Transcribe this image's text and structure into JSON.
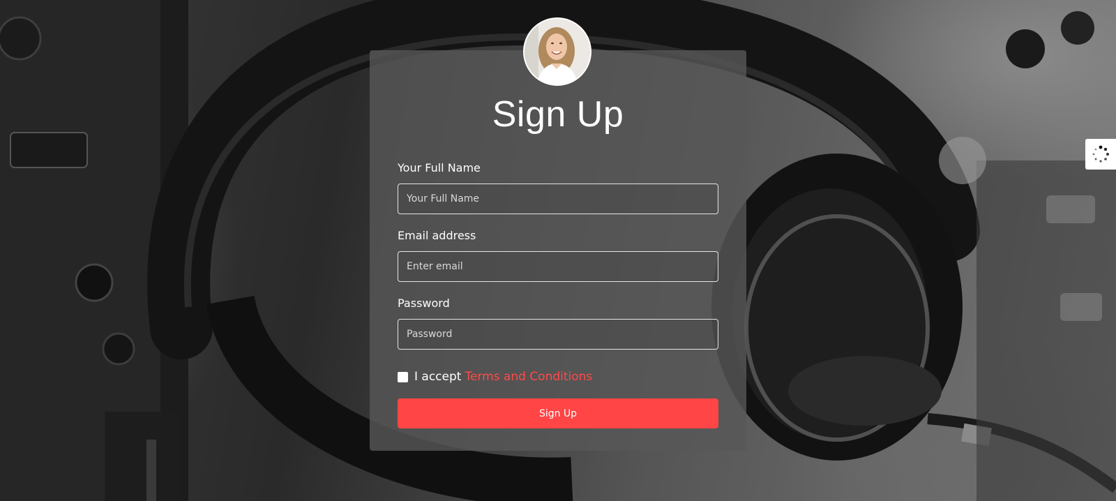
{
  "form": {
    "title": "Sign Up",
    "fields": [
      {
        "label": "Your Full Name",
        "placeholder": "Your Full Name",
        "value": ""
      },
      {
        "label": "Email address",
        "placeholder": "Enter email",
        "value": ""
      },
      {
        "label": "Password",
        "placeholder": "Password",
        "value": ""
      }
    ],
    "terms": {
      "prefix": "I accept",
      "link": "Terms and Conditions",
      "checked": false
    },
    "submit_label": "Sign Up"
  },
  "avatar": {
    "icon": "user-avatar-photo"
  },
  "loader": {
    "icon": "spinner-icon"
  },
  "colors": {
    "accent": "#ff4545",
    "link": "#ff4a4a",
    "card": "#585858",
    "text": "#ffffff"
  }
}
